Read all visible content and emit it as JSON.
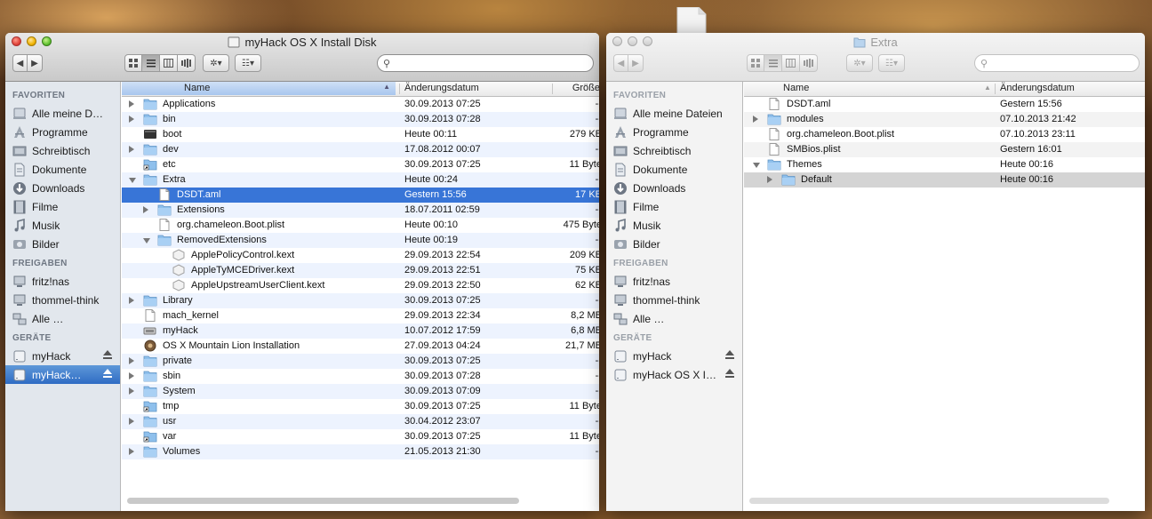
{
  "colors": {
    "selection": "#3875d7",
    "folder": "#8fc0ec"
  },
  "window_left": {
    "title": "myHack OS X Install Disk",
    "search_placeholder": "",
    "sidebar": {
      "sections": [
        {
          "header": "FAVORITEN",
          "items": [
            {
              "label": "Alle meine D…",
              "icon": "all-files-icon"
            },
            {
              "label": "Programme",
              "icon": "applications-icon"
            },
            {
              "label": "Schreibtisch",
              "icon": "desktop-icon"
            },
            {
              "label": "Dokumente",
              "icon": "documents-icon"
            },
            {
              "label": "Downloads",
              "icon": "downloads-icon"
            },
            {
              "label": "Filme",
              "icon": "movies-icon"
            },
            {
              "label": "Musik",
              "icon": "music-icon"
            },
            {
              "label": "Bilder",
              "icon": "pictures-icon"
            }
          ]
        },
        {
          "header": "FREIGABEN",
          "items": [
            {
              "label": "fritz!nas",
              "icon": "network-computer-icon"
            },
            {
              "label": "thommel-think",
              "icon": "network-computer-icon"
            },
            {
              "label": "Alle …",
              "icon": "network-icon"
            }
          ]
        },
        {
          "header": "GERÄTE",
          "items": [
            {
              "label": "myHack",
              "icon": "drive-icon",
              "eject": true
            },
            {
              "label": "myHack…",
              "icon": "drive-icon",
              "eject": true,
              "selected": true
            }
          ]
        }
      ]
    },
    "columns": {
      "name": "Name",
      "date": "Änderungsdatum",
      "size": "Größe"
    },
    "rows": [
      {
        "name": "Applications",
        "date": "30.09.2013 07:25",
        "size": "--",
        "level": 0,
        "kind": "folder",
        "disclosure": "closed"
      },
      {
        "name": "bin",
        "date": "30.09.2013 07:28",
        "size": "--",
        "level": 0,
        "kind": "folder",
        "disclosure": "closed"
      },
      {
        "name": "boot",
        "date": "Heute 00:11",
        "size": "279 KB",
        "level": 0,
        "kind": "exec"
      },
      {
        "name": "dev",
        "date": "17.08.2012 00:07",
        "size": "--",
        "level": 0,
        "kind": "folder",
        "disclosure": "closed"
      },
      {
        "name": "etc",
        "date": "30.09.2013 07:25",
        "size": "11 Byte",
        "level": 0,
        "kind": "alias"
      },
      {
        "name": "Extra",
        "date": "Heute 00:24",
        "size": "--",
        "level": 0,
        "kind": "folder",
        "disclosure": "open"
      },
      {
        "name": "DSDT.aml",
        "date": "Gestern 15:56",
        "size": "17 KB",
        "level": 1,
        "kind": "file",
        "selected": true
      },
      {
        "name": "Extensions",
        "date": "18.07.2011 02:59",
        "size": "--",
        "level": 1,
        "kind": "folder",
        "disclosure": "closed"
      },
      {
        "name": "org.chameleon.Boot.plist",
        "date": "Heute 00:10",
        "size": "475 Byte",
        "level": 1,
        "kind": "file"
      },
      {
        "name": "RemovedExtensions",
        "date": "Heute 00:19",
        "size": "--",
        "level": 1,
        "kind": "folder",
        "disclosure": "open"
      },
      {
        "name": "ApplePolicyControl.kext",
        "date": "29.09.2013 22:54",
        "size": "209 KB",
        "level": 2,
        "kind": "kext"
      },
      {
        "name": "AppleTyMCEDriver.kext",
        "date": "29.09.2013 22:51",
        "size": "75 KB",
        "level": 2,
        "kind": "kext"
      },
      {
        "name": "AppleUpstreamUserClient.kext",
        "date": "29.09.2013 22:50",
        "size": "62 KB",
        "level": 2,
        "kind": "kext"
      },
      {
        "name": "Library",
        "date": "30.09.2013 07:25",
        "size": "--",
        "level": 0,
        "kind": "folder",
        "disclosure": "closed"
      },
      {
        "name": "mach_kernel",
        "date": "29.09.2013 22:34",
        "size": "8,2 MB",
        "level": 0,
        "kind": "file"
      },
      {
        "name": "myHack",
        "date": "10.07.2012 17:59",
        "size": "6,8 MB",
        "level": 0,
        "kind": "app"
      },
      {
        "name": "OS X Mountain Lion Installation",
        "date": "27.09.2013 04:24",
        "size": "21,7 MB",
        "level": 0,
        "kind": "installer"
      },
      {
        "name": "private",
        "date": "30.09.2013 07:25",
        "size": "--",
        "level": 0,
        "kind": "folder",
        "disclosure": "closed"
      },
      {
        "name": "sbin",
        "date": "30.09.2013 07:28",
        "size": "--",
        "level": 0,
        "kind": "folder",
        "disclosure": "closed"
      },
      {
        "name": "System",
        "date": "30.09.2013 07:09",
        "size": "--",
        "level": 0,
        "kind": "folder",
        "disclosure": "closed"
      },
      {
        "name": "tmp",
        "date": "30.09.2013 07:25",
        "size": "11 Byte",
        "level": 0,
        "kind": "alias"
      },
      {
        "name": "usr",
        "date": "30.04.2012 23:07",
        "size": "--",
        "level": 0,
        "kind": "folder",
        "disclosure": "closed"
      },
      {
        "name": "var",
        "date": "30.09.2013 07:25",
        "size": "11 Byte",
        "level": 0,
        "kind": "alias"
      },
      {
        "name": "Volumes",
        "date": "21.05.2013 21:30",
        "size": "--",
        "level": 0,
        "kind": "folder",
        "disclosure": "closed"
      }
    ]
  },
  "window_right": {
    "title": "Extra",
    "search_placeholder": "",
    "sidebar": {
      "sections": [
        {
          "header": "FAVORITEN",
          "items": [
            {
              "label": "Alle meine Dateien",
              "icon": "all-files-icon"
            },
            {
              "label": "Programme",
              "icon": "applications-icon"
            },
            {
              "label": "Schreibtisch",
              "icon": "desktop-icon"
            },
            {
              "label": "Dokumente",
              "icon": "documents-icon"
            },
            {
              "label": "Downloads",
              "icon": "downloads-icon"
            },
            {
              "label": "Filme",
              "icon": "movies-icon"
            },
            {
              "label": "Musik",
              "icon": "music-icon"
            },
            {
              "label": "Bilder",
              "icon": "pictures-icon"
            }
          ]
        },
        {
          "header": "FREIGABEN",
          "items": [
            {
              "label": "fritz!nas",
              "icon": "network-computer-icon"
            },
            {
              "label": "thommel-think",
              "icon": "network-computer-icon"
            },
            {
              "label": "Alle …",
              "icon": "network-icon"
            }
          ]
        },
        {
          "header": "GERÄTE",
          "items": [
            {
              "label": "myHack",
              "icon": "drive-icon",
              "eject": true
            },
            {
              "label": "myHack OS X I…",
              "icon": "drive-icon",
              "eject": true
            }
          ]
        }
      ]
    },
    "columns": {
      "name": "Name",
      "date": "Änderungsdatum"
    },
    "rows": [
      {
        "name": "DSDT.aml",
        "date": "Gestern 15:56",
        "level": 0,
        "kind": "file"
      },
      {
        "name": "modules",
        "date": "07.10.2013 21:42",
        "level": 0,
        "kind": "folder",
        "disclosure": "closed"
      },
      {
        "name": "org.chameleon.Boot.plist",
        "date": "07.10.2013 23:11",
        "level": 0,
        "kind": "file"
      },
      {
        "name": "SMBios.plist",
        "date": "Gestern 16:01",
        "level": 0,
        "kind": "file"
      },
      {
        "name": "Themes",
        "date": "Heute 00:16",
        "level": 0,
        "kind": "folder",
        "disclosure": "open"
      },
      {
        "name": "Default",
        "date": "Heute 00:16",
        "level": 1,
        "kind": "folder",
        "disclosure": "closed",
        "selected_inactive": true
      }
    ]
  }
}
